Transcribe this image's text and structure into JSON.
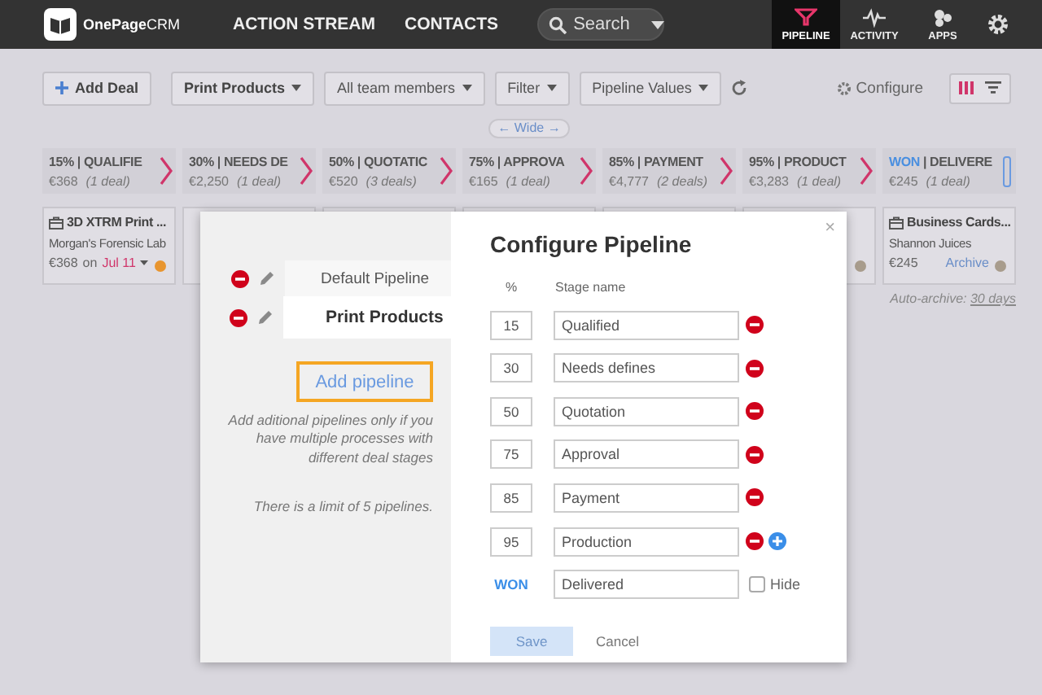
{
  "topbar": {
    "logo_text": "**OnePage**CRM",
    "nav": [
      "ACTION STREAM",
      "CONTACTS"
    ],
    "search": {
      "placeholder": "Search"
    },
    "apps": [
      {
        "label": "PIPELINE",
        "kind": "pipeline",
        "selected": true
      },
      {
        "label": "ACTIVITY",
        "kind": "activity",
        "selected": false
      },
      {
        "label": "APPS",
        "kind": "apps",
        "selected": false
      }
    ]
  },
  "toolbar": {
    "add_deal": "Add Deal",
    "filters": [
      {
        "label": "Print Products",
        "bold": true
      },
      {
        "label": "All team members",
        "bold": false
      },
      {
        "label": "Filter",
        "bold": false
      },
      {
        "label": "Pipeline Values",
        "bold": false
      }
    ],
    "configure": "Configure",
    "views": [
      {
        "kind": "columns",
        "selected": true
      },
      {
        "kind": "list",
        "selected": false
      }
    ]
  },
  "wide_label": "← Wide →",
  "stages": [
    {
      "percent": "15%",
      "name": "| QUALIFIE",
      "amount": "€368",
      "count": "(1 deal)",
      "kind": "open"
    },
    {
      "percent": "30%",
      "name": "| NEEDS DE",
      "amount": "€2,250",
      "count": "(1 deal)",
      "kind": "open"
    },
    {
      "percent": "50%",
      "name": "| QUOTATIC",
      "amount": "€520",
      "count": "(3 deals)",
      "kind": "open"
    },
    {
      "percent": "75%",
      "name": "| APPROVA",
      "amount": "€165",
      "count": "(1 deal)",
      "kind": "open"
    },
    {
      "percent": "85%",
      "name": "| PAYMENT",
      "amount": "€4,777",
      "count": "(2 deals)",
      "kind": "open"
    },
    {
      "percent": "95%",
      "name": "| PRODUCT",
      "amount": "€3,283",
      "count": "(1 deal)",
      "kind": "open"
    },
    {
      "percent": "WON",
      "name": "| DELIVERE",
      "amount": "€245",
      "count": "(1 deal)",
      "kind": "won"
    }
  ],
  "deals": [
    {
      "kind": "open",
      "title": "3D XTRM Print ...",
      "contact": "Morgan's Forensic Lab",
      "amount": "€368",
      "on": "on",
      "date": "Jul 11",
      "color": "#e8952f"
    },
    {
      "kind": "covered"
    },
    {
      "kind": "covered"
    },
    {
      "kind": "covered"
    },
    {
      "kind": "covered"
    },
    {
      "kind": "covered",
      "color": "#a89c8c"
    },
    {
      "kind": "won",
      "title": "Business Cards...",
      "contact": "Shannon Juices",
      "amount": "€245",
      "action": "Archive",
      "color": "#a89c8c"
    }
  ],
  "auto_archive": {
    "label": "Auto-archive:",
    "link": "30 days"
  },
  "modal": {
    "title": "Configure Pipeline",
    "close": "×",
    "pipelines": [
      {
        "name": "Default Pipeline",
        "selected": false
      },
      {
        "name": "Print Products",
        "selected": true
      }
    ],
    "add_pipeline": "Add pipeline",
    "help": "Add aditional pipelines only if you have multiple processes with different deal stages",
    "limit": "There is a limit of 5 pipelines.",
    "columns": {
      "percent": "%",
      "name": "Stage name"
    },
    "stages": [
      {
        "kind": "stage",
        "percent": "15",
        "name": "Qualified",
        "addable": false
      },
      {
        "kind": "stage",
        "percent": "30",
        "name": "Needs defines",
        "addable": false
      },
      {
        "kind": "stage",
        "percent": "50",
        "name": "Quotation",
        "addable": false
      },
      {
        "kind": "stage",
        "percent": "75",
        "name": "Approval",
        "addable": false
      },
      {
        "kind": "stage",
        "percent": "85",
        "name": "Payment",
        "addable": false
      },
      {
        "kind": "stage",
        "percent": "95",
        "name": "Production",
        "addable": true
      },
      {
        "kind": "won",
        "percent": "WON",
        "name": "Delivered"
      }
    ],
    "hide": {
      "label": "Hide",
      "checked": false
    },
    "save": {
      "label": "Save",
      "disabled": true
    },
    "cancel": "Cancel"
  }
}
